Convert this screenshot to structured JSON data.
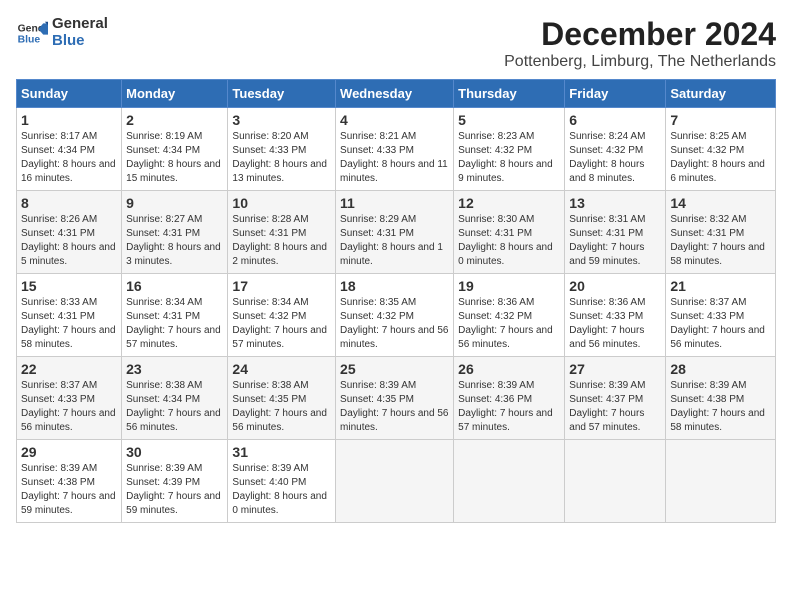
{
  "logo": {
    "line1": "General",
    "line2": "Blue"
  },
  "title": "December 2024",
  "subtitle": "Pottenberg, Limburg, The Netherlands",
  "weekdays": [
    "Sunday",
    "Monday",
    "Tuesday",
    "Wednesday",
    "Thursday",
    "Friday",
    "Saturday"
  ],
  "weeks": [
    [
      {
        "day": "1",
        "sunrise": "Sunrise: 8:17 AM",
        "sunset": "Sunset: 4:34 PM",
        "daylight": "Daylight: 8 hours and 16 minutes."
      },
      {
        "day": "2",
        "sunrise": "Sunrise: 8:19 AM",
        "sunset": "Sunset: 4:34 PM",
        "daylight": "Daylight: 8 hours and 15 minutes."
      },
      {
        "day": "3",
        "sunrise": "Sunrise: 8:20 AM",
        "sunset": "Sunset: 4:33 PM",
        "daylight": "Daylight: 8 hours and 13 minutes."
      },
      {
        "day": "4",
        "sunrise": "Sunrise: 8:21 AM",
        "sunset": "Sunset: 4:33 PM",
        "daylight": "Daylight: 8 hours and 11 minutes."
      },
      {
        "day": "5",
        "sunrise": "Sunrise: 8:23 AM",
        "sunset": "Sunset: 4:32 PM",
        "daylight": "Daylight: 8 hours and 9 minutes."
      },
      {
        "day": "6",
        "sunrise": "Sunrise: 8:24 AM",
        "sunset": "Sunset: 4:32 PM",
        "daylight": "Daylight: 8 hours and 8 minutes."
      },
      {
        "day": "7",
        "sunrise": "Sunrise: 8:25 AM",
        "sunset": "Sunset: 4:32 PM",
        "daylight": "Daylight: 8 hours and 6 minutes."
      }
    ],
    [
      {
        "day": "8",
        "sunrise": "Sunrise: 8:26 AM",
        "sunset": "Sunset: 4:31 PM",
        "daylight": "Daylight: 8 hours and 5 minutes."
      },
      {
        "day": "9",
        "sunrise": "Sunrise: 8:27 AM",
        "sunset": "Sunset: 4:31 PM",
        "daylight": "Daylight: 8 hours and 3 minutes."
      },
      {
        "day": "10",
        "sunrise": "Sunrise: 8:28 AM",
        "sunset": "Sunset: 4:31 PM",
        "daylight": "Daylight: 8 hours and 2 minutes."
      },
      {
        "day": "11",
        "sunrise": "Sunrise: 8:29 AM",
        "sunset": "Sunset: 4:31 PM",
        "daylight": "Daylight: 8 hours and 1 minute."
      },
      {
        "day": "12",
        "sunrise": "Sunrise: 8:30 AM",
        "sunset": "Sunset: 4:31 PM",
        "daylight": "Daylight: 8 hours and 0 minutes."
      },
      {
        "day": "13",
        "sunrise": "Sunrise: 8:31 AM",
        "sunset": "Sunset: 4:31 PM",
        "daylight": "Daylight: 7 hours and 59 minutes."
      },
      {
        "day": "14",
        "sunrise": "Sunrise: 8:32 AM",
        "sunset": "Sunset: 4:31 PM",
        "daylight": "Daylight: 7 hours and 58 minutes."
      }
    ],
    [
      {
        "day": "15",
        "sunrise": "Sunrise: 8:33 AM",
        "sunset": "Sunset: 4:31 PM",
        "daylight": "Daylight: 7 hours and 58 minutes."
      },
      {
        "day": "16",
        "sunrise": "Sunrise: 8:34 AM",
        "sunset": "Sunset: 4:31 PM",
        "daylight": "Daylight: 7 hours and 57 minutes."
      },
      {
        "day": "17",
        "sunrise": "Sunrise: 8:34 AM",
        "sunset": "Sunset: 4:32 PM",
        "daylight": "Daylight: 7 hours and 57 minutes."
      },
      {
        "day": "18",
        "sunrise": "Sunrise: 8:35 AM",
        "sunset": "Sunset: 4:32 PM",
        "daylight": "Daylight: 7 hours and 56 minutes."
      },
      {
        "day": "19",
        "sunrise": "Sunrise: 8:36 AM",
        "sunset": "Sunset: 4:32 PM",
        "daylight": "Daylight: 7 hours and 56 minutes."
      },
      {
        "day": "20",
        "sunrise": "Sunrise: 8:36 AM",
        "sunset": "Sunset: 4:33 PM",
        "daylight": "Daylight: 7 hours and 56 minutes."
      },
      {
        "day": "21",
        "sunrise": "Sunrise: 8:37 AM",
        "sunset": "Sunset: 4:33 PM",
        "daylight": "Daylight: 7 hours and 56 minutes."
      }
    ],
    [
      {
        "day": "22",
        "sunrise": "Sunrise: 8:37 AM",
        "sunset": "Sunset: 4:33 PM",
        "daylight": "Daylight: 7 hours and 56 minutes."
      },
      {
        "day": "23",
        "sunrise": "Sunrise: 8:38 AM",
        "sunset": "Sunset: 4:34 PM",
        "daylight": "Daylight: 7 hours and 56 minutes."
      },
      {
        "day": "24",
        "sunrise": "Sunrise: 8:38 AM",
        "sunset": "Sunset: 4:35 PM",
        "daylight": "Daylight: 7 hours and 56 minutes."
      },
      {
        "day": "25",
        "sunrise": "Sunrise: 8:39 AM",
        "sunset": "Sunset: 4:35 PM",
        "daylight": "Daylight: 7 hours and 56 minutes."
      },
      {
        "day": "26",
        "sunrise": "Sunrise: 8:39 AM",
        "sunset": "Sunset: 4:36 PM",
        "daylight": "Daylight: 7 hours and 57 minutes."
      },
      {
        "day": "27",
        "sunrise": "Sunrise: 8:39 AM",
        "sunset": "Sunset: 4:37 PM",
        "daylight": "Daylight: 7 hours and 57 minutes."
      },
      {
        "day": "28",
        "sunrise": "Sunrise: 8:39 AM",
        "sunset": "Sunset: 4:38 PM",
        "daylight": "Daylight: 7 hours and 58 minutes."
      }
    ],
    [
      {
        "day": "29",
        "sunrise": "Sunrise: 8:39 AM",
        "sunset": "Sunset: 4:38 PM",
        "daylight": "Daylight: 7 hours and 59 minutes."
      },
      {
        "day": "30",
        "sunrise": "Sunrise: 8:39 AM",
        "sunset": "Sunset: 4:39 PM",
        "daylight": "Daylight: 7 hours and 59 minutes."
      },
      {
        "day": "31",
        "sunrise": "Sunrise: 8:39 AM",
        "sunset": "Sunset: 4:40 PM",
        "daylight": "Daylight: 8 hours and 0 minutes."
      },
      null,
      null,
      null,
      null
    ]
  ]
}
